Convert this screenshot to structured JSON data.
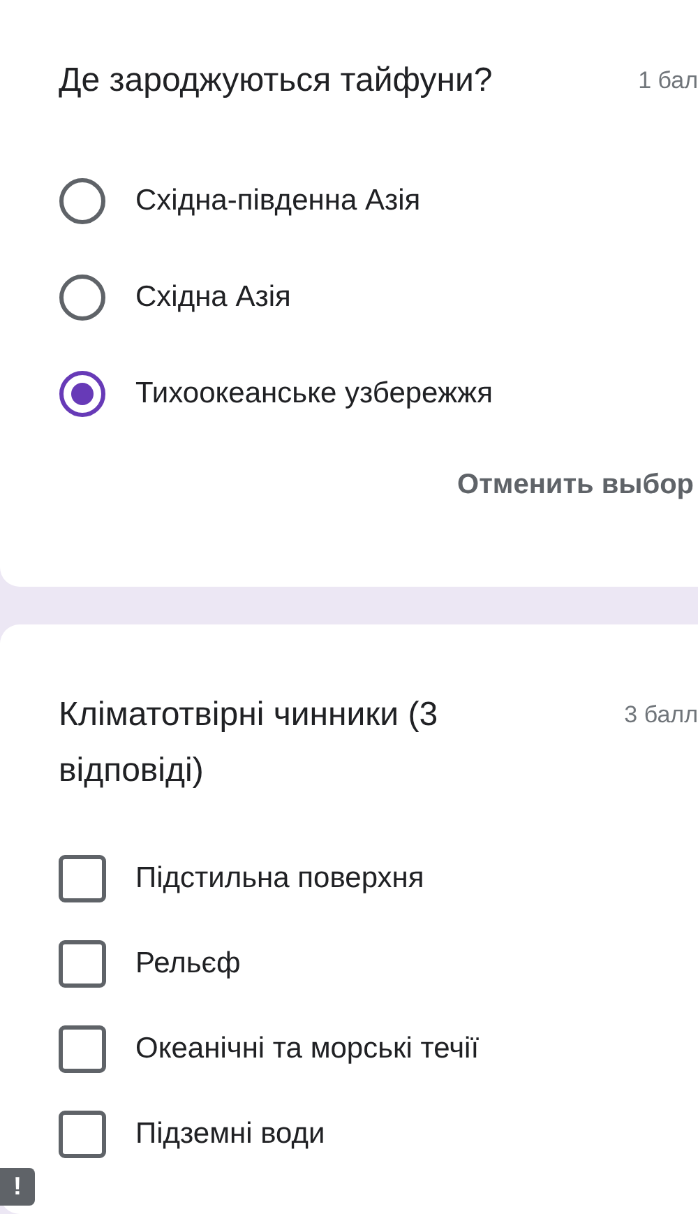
{
  "questions": [
    {
      "kind": "radio",
      "title": "Де зароджуються тайфуни?",
      "points": "1 бал",
      "options": [
        {
          "label": "Східна-південна Азія",
          "selected": false
        },
        {
          "label": "Східна Азія",
          "selected": false
        },
        {
          "label": "Тихоокеанське узбережжя",
          "selected": true
        }
      ],
      "clear_button": "Отменить выбор"
    },
    {
      "kind": "checkbox",
      "title": "Кліматотвірні чинники (3 відповіді)",
      "points": "3 балл",
      "options": [
        {
          "label": "Підстильна поверхня",
          "checked": false
        },
        {
          "label": "Рельєф",
          "checked": false
        },
        {
          "label": "Океанічні та морські течії",
          "checked": false
        },
        {
          "label": "Підземні води",
          "checked": false
        }
      ]
    }
  ],
  "alert_badge": "!"
}
